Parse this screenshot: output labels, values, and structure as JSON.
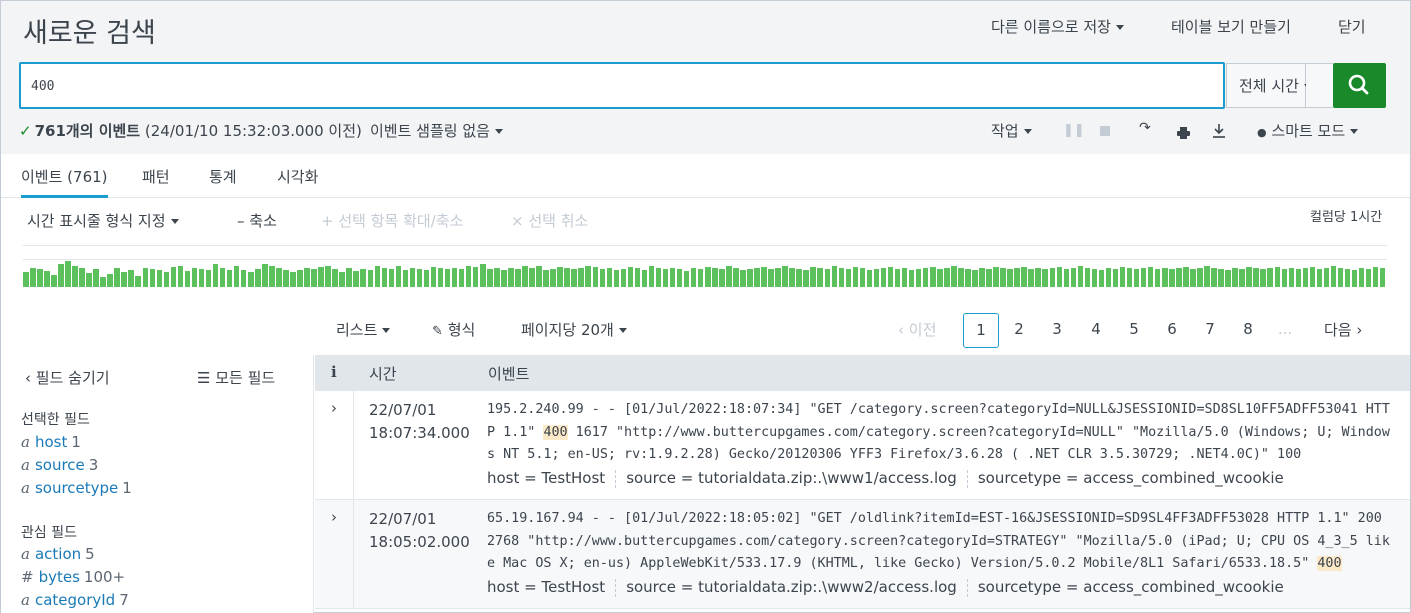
{
  "header": {
    "title": "새로운 검색",
    "save_as": "다른 이름으로 저장",
    "create_table_view": "테이블 보기 만들기",
    "close": "닫기"
  },
  "search": {
    "query": "400",
    "time_range": "전체 시간"
  },
  "status": {
    "count_label": "761개의 이벤트",
    "time_note": "(24/01/10 15:32:03.000 이전)",
    "sampling": "이벤트 샘플링 없음"
  },
  "jobbar": {
    "job": "작업",
    "smart_mode": "스마트 모드"
  },
  "tabs": [
    {
      "label": "이벤트 (761)",
      "active": true
    },
    {
      "label": "패턴"
    },
    {
      "label": "통계"
    },
    {
      "label": "시각화"
    }
  ],
  "timeline": {
    "format_time": "시간 표시줄 형식 지정",
    "zoom_out": "축소",
    "zoom_selection": "선택 항목 확대/축소",
    "deselect": "선택 취소",
    "per_column": "컬럼당 1시간",
    "bar_color": "#5cc05c",
    "bars": [
      0.35,
      0.45,
      0.42,
      0.38,
      0.28,
      0.55,
      0.65,
      0.52,
      0.45,
      0.32,
      0.42,
      0.22,
      0.3,
      0.45,
      0.35,
      0.4,
      0.25,
      0.45,
      0.42,
      0.4,
      0.35,
      0.48,
      0.5,
      0.38,
      0.45,
      0.42,
      0.4,
      0.55,
      0.45,
      0.4,
      0.5,
      0.4,
      0.35,
      0.42,
      0.55,
      0.5,
      0.45,
      0.4,
      0.35,
      0.4,
      0.45,
      0.42,
      0.48,
      0.5,
      0.42,
      0.35,
      0.45,
      0.38,
      0.42,
      0.4,
      0.5,
      0.45,
      0.42,
      0.52,
      0.4,
      0.45,
      0.42,
      0.4,
      0.48,
      0.45,
      0.42,
      0.45,
      0.42,
      0.5,
      0.48,
      0.55,
      0.42,
      0.45,
      0.4,
      0.45,
      0.42,
      0.5,
      0.45,
      0.52,
      0.4,
      0.42,
      0.48,
      0.45,
      0.42,
      0.45,
      0.5,
      0.48,
      0.42,
      0.45,
      0.4,
      0.42,
      0.48,
      0.45,
      0.4,
      0.5,
      0.45,
      0.42,
      0.45,
      0.42,
      0.38,
      0.45,
      0.42,
      0.48,
      0.45,
      0.42,
      0.5,
      0.45,
      0.4,
      0.42,
      0.45,
      0.48,
      0.42,
      0.45,
      0.5,
      0.45,
      0.42,
      0.4,
      0.48,
      0.45,
      0.42,
      0.5,
      0.45,
      0.42,
      0.48,
      0.45,
      0.4,
      0.42,
      0.45,
      0.48,
      0.42,
      0.45,
      0.4,
      0.42,
      0.45,
      0.48,
      0.42,
      0.45,
      0.5,
      0.45,
      0.42,
      0.4,
      0.45,
      0.42,
      0.48,
      0.45,
      0.42,
      0.45,
      0.48,
      0.42,
      0.45,
      0.42,
      0.45,
      0.48,
      0.42,
      0.45,
      0.5,
      0.45,
      0.42,
      0.4,
      0.45,
      0.42,
      0.48,
      0.45,
      0.42,
      0.45,
      0.48,
      0.42,
      0.45,
      0.42,
      0.45,
      0.48,
      0.42,
      0.45,
      0.5,
      0.45,
      0.42,
      0.4,
      0.45,
      0.42,
      0.48,
      0.45,
      0.42,
      0.45,
      0.48,
      0.42,
      0.45,
      0.42,
      0.45,
      0.48,
      0.42,
      0.45,
      0.5,
      0.45,
      0.42,
      0.4,
      0.45,
      0.42,
      0.48,
      0.45
    ]
  },
  "results": {
    "list": "리스트",
    "format": "형식",
    "per_page": "페이지당 20개",
    "prev": "이전",
    "pages": [
      "1",
      "2",
      "3",
      "4",
      "5",
      "6",
      "7",
      "8"
    ],
    "ellipsis": "...",
    "next": "다음"
  },
  "sidebar": {
    "hide_fields": "필드 숨기기",
    "all_fields": "모든 필드",
    "selected_title": "선택한 필드",
    "selected": [
      {
        "type": "a",
        "name": "host",
        "count": "1"
      },
      {
        "type": "a",
        "name": "source",
        "count": "3"
      },
      {
        "type": "a",
        "name": "sourcetype",
        "count": "1"
      }
    ],
    "interesting_title": "관심 필드",
    "interesting": [
      {
        "type": "a",
        "name": "action",
        "count": "5"
      },
      {
        "type": "#",
        "name": "bytes",
        "count": "100+"
      },
      {
        "type": "a",
        "name": "categoryId",
        "count": "7"
      }
    ]
  },
  "table": {
    "col_info": "i",
    "col_time": "시간",
    "col_event": "이벤트",
    "rows": [
      {
        "date": "22/07/01",
        "time": "18:07:34.000",
        "raw_before": "195.2.240.99 - - [01/Jul/2022:18:07:34] \"GET /category.screen?categoryId=NULL&JSESSIONID=SD8SL10FF5ADFF53041 HTTP 1.1\" ",
        "raw_hl": "400",
        "raw_after": " 1617 \"http://www.buttercupgames.com/category.screen?categoryId=NULL\" \"Mozilla/5.0 (Windows; U; Windows NT 5.1; en-US; rv:1.9.2.28) Gecko/20120306 YFF3 Firefox/3.6.28 ( .NET CLR 3.5.30729; .NET4.0C)\" 100",
        "host": "host = TestHost",
        "source": "source = tutorialdata.zip:.\\www1/access.log",
        "sourcetype": "sourcetype = access_combined_wcookie"
      },
      {
        "date": "22/07/01",
        "time": "18:05:02.000",
        "raw_before": "65.19.167.94 - - [01/Jul/2022:18:05:02] \"GET /oldlink?itemId=EST-16&JSESSIONID=SD9SL4FF3ADFF53028 HTTP 1.1\" 200 2768 \"http://www.buttercupgames.com/category.screen?categoryId=STRATEGY\" \"Mozilla/5.0 (iPad; U; CPU OS 4_3_5 like Mac OS X; en-us) AppleWebKit/533.17.9 (KHTML, like Gecko) Version/5.0.2 Mobile/8L1 Safari/6533.18.5\" ",
        "raw_hl": "400",
        "raw_after": "",
        "host": "host = TestHost",
        "source": "source = tutorialdata.zip:.\\www2/access.log",
        "sourcetype": "sourcetype = access_combined_wcookie"
      }
    ]
  }
}
